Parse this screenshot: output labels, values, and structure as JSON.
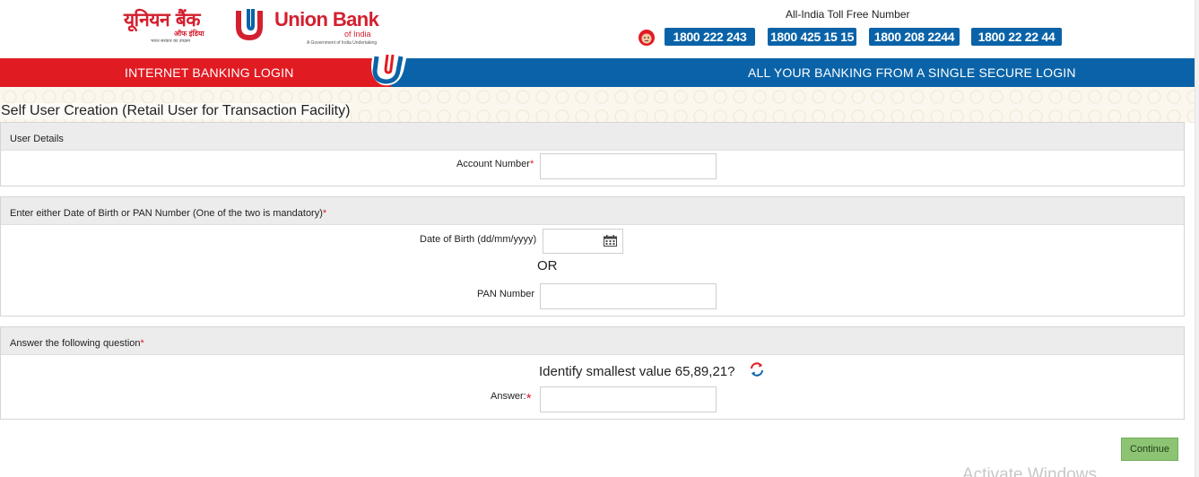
{
  "header": {
    "logo": {
      "hindi_name": "यूनियन बैंक",
      "hindi_sub": "ऑफ इंडिया",
      "hindi_tagline": "भारत सरकार का उपक्रम",
      "name": "Union Bank",
      "sub": "of India",
      "tagline": "A Government of India Undertaking"
    },
    "toll_free_title": "All-India Toll Free Number",
    "toll_free_numbers": [
      "1800 222 243",
      "1800 425 15 15",
      "1800 208 2244",
      "1800 22 22 44"
    ],
    "helpline_icon": "helpline-face-icon"
  },
  "banner": {
    "left_text": "INTERNET BANKING LOGIN",
    "right_text": "ALL YOUR BANKING FROM A SINGLE SECURE LOGIN",
    "colors": {
      "red": "#e11b22",
      "blue": "#0a63a8"
    }
  },
  "form": {
    "title": "Self User Creation (Retail User for Transaction Facility)",
    "user_details": {
      "heading": "User Details",
      "account_label": "Account Number",
      "account_value": ""
    },
    "dob_pan": {
      "heading": "Enter either Date of Birth or PAN Number (One of the two is mandatory)",
      "dob_label": "Date of Birth (dd/mm/yyyy)",
      "dob_value": "",
      "or_text": "OR",
      "pan_label": "PAN Number",
      "pan_value": ""
    },
    "question": {
      "heading": "Answer the following question",
      "text": "Identify smallest value 65,89,21?",
      "answer_label": "Answer:",
      "answer_value": ""
    },
    "required_marker": "*",
    "continue_label": "Continue"
  },
  "watermark": "Activate Windows"
}
